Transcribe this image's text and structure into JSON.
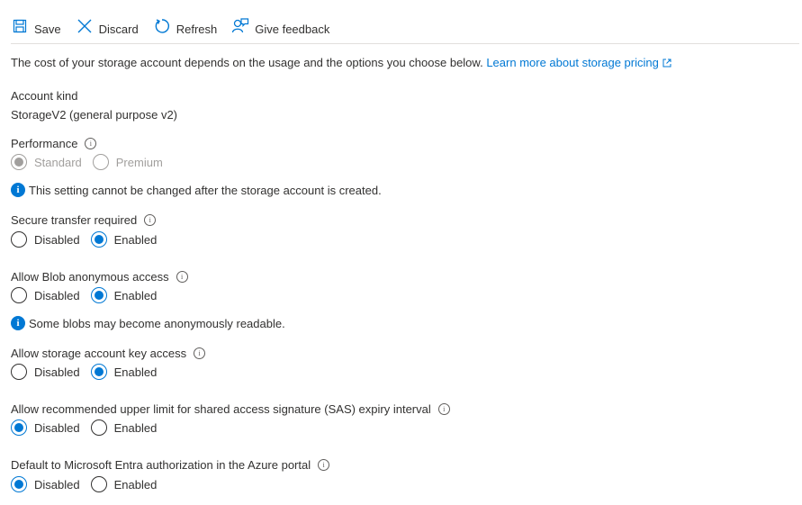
{
  "toolbar": {
    "save": "Save",
    "discard": "Discard",
    "refresh": "Refresh",
    "feedback": "Give feedback"
  },
  "intro": {
    "text": "The cost of your storage account depends on the usage and the options you choose below.",
    "link": "Learn more about storage pricing"
  },
  "account_kind": {
    "label": "Account kind",
    "value": "StorageV2 (general purpose v2)"
  },
  "performance": {
    "label": "Performance",
    "options": [
      "Standard",
      "Premium"
    ],
    "selected": "Standard",
    "note": "This setting cannot be changed after the storage account is created."
  },
  "secure_transfer": {
    "label": "Secure transfer required",
    "options": [
      "Disabled",
      "Enabled"
    ],
    "selected": "Enabled"
  },
  "blob_anonymous": {
    "label": "Allow Blob anonymous access",
    "options": [
      "Disabled",
      "Enabled"
    ],
    "selected": "Enabled",
    "note": "Some blobs may become anonymously readable."
  },
  "key_access": {
    "label": "Allow storage account key access",
    "options": [
      "Disabled",
      "Enabled"
    ],
    "selected": "Enabled"
  },
  "sas_expiry": {
    "label": "Allow recommended upper limit for shared access signature (SAS) expiry interval",
    "options": [
      "Disabled",
      "Enabled"
    ],
    "selected": "Disabled"
  },
  "entra_auth": {
    "label": "Default to Microsoft Entra authorization in the Azure portal",
    "options": [
      "Disabled",
      "Enabled"
    ],
    "selected": "Disabled"
  },
  "colors": {
    "accent": "#0078d4",
    "text": "#323130",
    "disabled": "#a19f9d"
  }
}
